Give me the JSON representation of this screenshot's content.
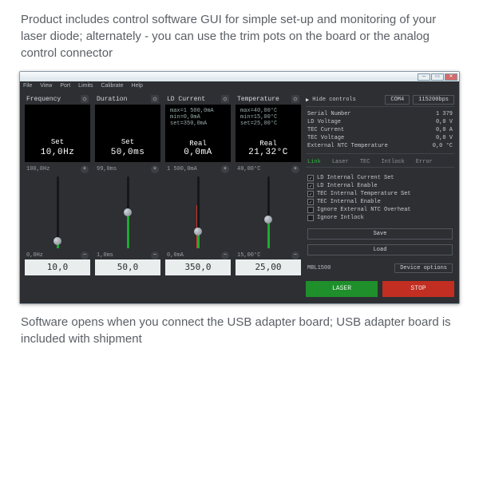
{
  "caption_top": "Product includes control software GUI for simple set-up and monitoring of your laser diode; alternately - you can use the trim pots on the board or the analog control connector",
  "caption_bottom": "Software opens when you connect the USB adapter board; USB adapter board is included with shipment",
  "menu": {
    "file": "File",
    "view": "View",
    "port": "Port",
    "limits": "Limits",
    "calibrate": "Calibrate",
    "help": "Help"
  },
  "cols": {
    "freq": {
      "head": "Frequency",
      "label": "Set",
      "value": "10,0Hz",
      "top": "100,0Hz",
      "bot": "0,0Hz",
      "entry": "10,0",
      "fill": 10,
      "knob": 10
    },
    "dur": {
      "head": "Duration",
      "label": "Set",
      "value": "50,0ms",
      "top": "99,0ms",
      "bot": "1,0ms",
      "entry": "50,0",
      "fill": 50,
      "knob": 50
    },
    "current": {
      "head": "LD Current",
      "label": "Real",
      "value": "0,0mA",
      "top": "1 500,0mA",
      "bot": "0,0mA",
      "entry": "350,0",
      "fill": 23,
      "knob": 23,
      "info1": "max=1 500,0mA",
      "info2": "min=0,0mA",
      "info3": "set=350,0mA",
      "red": true
    },
    "temp": {
      "head": "Temperature",
      "label": "Real",
      "value": "21,32°C",
      "top": "40,00°C",
      "bot": "15,00°C",
      "entry": "25,00",
      "fill": 40,
      "knob": 40,
      "info1": "max=40,00°C",
      "info2": "min=15,00°C",
      "info3": "set=25,00°C"
    }
  },
  "right": {
    "hide": "Hide controls",
    "com": "COM4",
    "baud": "115200bps",
    "info": {
      "serial_l": "Serial Number",
      "serial_v": "1 379",
      "ldv_l": "LD Voltage",
      "ldv_v": "0,0  V",
      "tecc_l": "TEC Current",
      "tecc_v": "0,0  A",
      "tecv_l": "TEC Voltage",
      "tecv_v": "0,0  V",
      "ext_l": "External NTC Temperature",
      "ext_v": "0,0 °C"
    },
    "tabs": {
      "link": "Link",
      "laser": "Laser",
      "tec": "TEC",
      "intlock": "Intlock",
      "error": "Error"
    },
    "checks": {
      "c1": "LD Internal Current Set",
      "c2": "LD Internal Enable",
      "c3": "TEC Internal Temperature Set",
      "c4": "TEC Internal Enable",
      "c5": "Ignore External NTC Overheat",
      "c6": "Ignore Intlock"
    },
    "save": "Save",
    "load": "Load",
    "device": "MBL1500",
    "dev_opt": "Device options",
    "laser_btn": "LASER",
    "stop_btn": "STOP"
  }
}
